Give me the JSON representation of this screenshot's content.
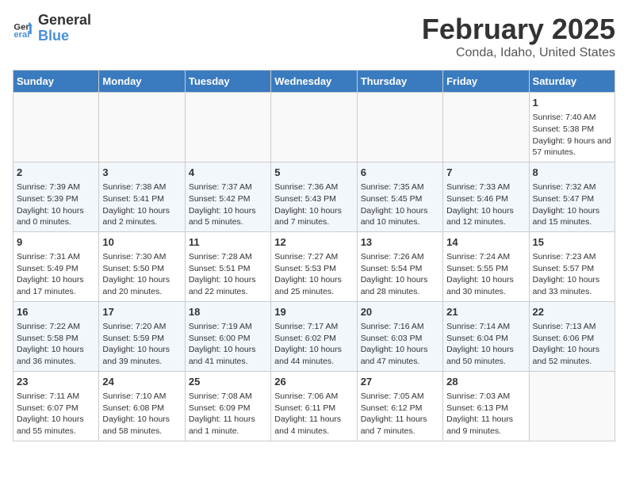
{
  "header": {
    "logo_line1": "General",
    "logo_line2": "Blue",
    "month": "February 2025",
    "location": "Conda, Idaho, United States"
  },
  "days_of_week": [
    "Sunday",
    "Monday",
    "Tuesday",
    "Wednesday",
    "Thursday",
    "Friday",
    "Saturday"
  ],
  "weeks": [
    [
      {
        "num": "",
        "info": ""
      },
      {
        "num": "",
        "info": ""
      },
      {
        "num": "",
        "info": ""
      },
      {
        "num": "",
        "info": ""
      },
      {
        "num": "",
        "info": ""
      },
      {
        "num": "",
        "info": ""
      },
      {
        "num": "1",
        "info": "Sunrise: 7:40 AM\nSunset: 5:38 PM\nDaylight: 9 hours and 57 minutes."
      }
    ],
    [
      {
        "num": "2",
        "info": "Sunrise: 7:39 AM\nSunset: 5:39 PM\nDaylight: 10 hours and 0 minutes."
      },
      {
        "num": "3",
        "info": "Sunrise: 7:38 AM\nSunset: 5:41 PM\nDaylight: 10 hours and 2 minutes."
      },
      {
        "num": "4",
        "info": "Sunrise: 7:37 AM\nSunset: 5:42 PM\nDaylight: 10 hours and 5 minutes."
      },
      {
        "num": "5",
        "info": "Sunrise: 7:36 AM\nSunset: 5:43 PM\nDaylight: 10 hours and 7 minutes."
      },
      {
        "num": "6",
        "info": "Sunrise: 7:35 AM\nSunset: 5:45 PM\nDaylight: 10 hours and 10 minutes."
      },
      {
        "num": "7",
        "info": "Sunrise: 7:33 AM\nSunset: 5:46 PM\nDaylight: 10 hours and 12 minutes."
      },
      {
        "num": "8",
        "info": "Sunrise: 7:32 AM\nSunset: 5:47 PM\nDaylight: 10 hours and 15 minutes."
      }
    ],
    [
      {
        "num": "9",
        "info": "Sunrise: 7:31 AM\nSunset: 5:49 PM\nDaylight: 10 hours and 17 minutes."
      },
      {
        "num": "10",
        "info": "Sunrise: 7:30 AM\nSunset: 5:50 PM\nDaylight: 10 hours and 20 minutes."
      },
      {
        "num": "11",
        "info": "Sunrise: 7:28 AM\nSunset: 5:51 PM\nDaylight: 10 hours and 22 minutes."
      },
      {
        "num": "12",
        "info": "Sunrise: 7:27 AM\nSunset: 5:53 PM\nDaylight: 10 hours and 25 minutes."
      },
      {
        "num": "13",
        "info": "Sunrise: 7:26 AM\nSunset: 5:54 PM\nDaylight: 10 hours and 28 minutes."
      },
      {
        "num": "14",
        "info": "Sunrise: 7:24 AM\nSunset: 5:55 PM\nDaylight: 10 hours and 30 minutes."
      },
      {
        "num": "15",
        "info": "Sunrise: 7:23 AM\nSunset: 5:57 PM\nDaylight: 10 hours and 33 minutes."
      }
    ],
    [
      {
        "num": "16",
        "info": "Sunrise: 7:22 AM\nSunset: 5:58 PM\nDaylight: 10 hours and 36 minutes."
      },
      {
        "num": "17",
        "info": "Sunrise: 7:20 AM\nSunset: 5:59 PM\nDaylight: 10 hours and 39 minutes."
      },
      {
        "num": "18",
        "info": "Sunrise: 7:19 AM\nSunset: 6:00 PM\nDaylight: 10 hours and 41 minutes."
      },
      {
        "num": "19",
        "info": "Sunrise: 7:17 AM\nSunset: 6:02 PM\nDaylight: 10 hours and 44 minutes."
      },
      {
        "num": "20",
        "info": "Sunrise: 7:16 AM\nSunset: 6:03 PM\nDaylight: 10 hours and 47 minutes."
      },
      {
        "num": "21",
        "info": "Sunrise: 7:14 AM\nSunset: 6:04 PM\nDaylight: 10 hours and 50 minutes."
      },
      {
        "num": "22",
        "info": "Sunrise: 7:13 AM\nSunset: 6:06 PM\nDaylight: 10 hours and 52 minutes."
      }
    ],
    [
      {
        "num": "23",
        "info": "Sunrise: 7:11 AM\nSunset: 6:07 PM\nDaylight: 10 hours and 55 minutes."
      },
      {
        "num": "24",
        "info": "Sunrise: 7:10 AM\nSunset: 6:08 PM\nDaylight: 10 hours and 58 minutes."
      },
      {
        "num": "25",
        "info": "Sunrise: 7:08 AM\nSunset: 6:09 PM\nDaylight: 11 hours and 1 minute."
      },
      {
        "num": "26",
        "info": "Sunrise: 7:06 AM\nSunset: 6:11 PM\nDaylight: 11 hours and 4 minutes."
      },
      {
        "num": "27",
        "info": "Sunrise: 7:05 AM\nSunset: 6:12 PM\nDaylight: 11 hours and 7 minutes."
      },
      {
        "num": "28",
        "info": "Sunrise: 7:03 AM\nSunset: 6:13 PM\nDaylight: 11 hours and 9 minutes."
      },
      {
        "num": "",
        "info": ""
      }
    ]
  ]
}
